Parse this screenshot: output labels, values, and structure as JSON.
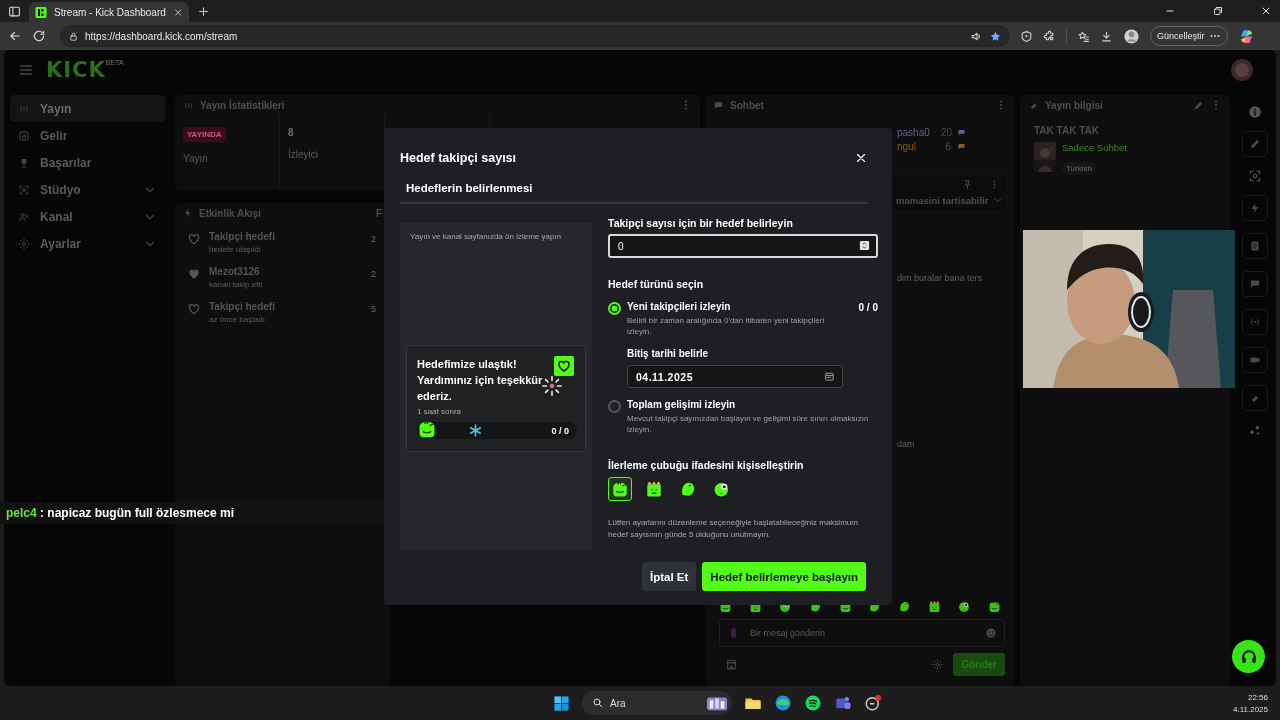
{
  "browser": {
    "tab": {
      "title": "Stream - Kick Dashboard"
    },
    "url": "https://dashboard.kick.com/stream",
    "update_button": "Güncelleştir"
  },
  "header": {
    "logo": "KICK",
    "logo_badge": "BETA"
  },
  "sidebar": {
    "items": [
      {
        "label": "Yayın",
        "selected": true,
        "expandable": false
      },
      {
        "label": "Gelir",
        "selected": false,
        "expandable": false
      },
      {
        "label": "Başarılar",
        "selected": false,
        "expandable": false
      },
      {
        "label": "Stüdyo",
        "selected": false,
        "expandable": true
      },
      {
        "label": "Kanal",
        "selected": false,
        "expandable": true
      },
      {
        "label": "Ayarlar",
        "selected": false,
        "expandable": true
      }
    ]
  },
  "stats_panel": {
    "title": "Yayın İstatistikleri",
    "status_badge": "YAYINDA",
    "status_label": "Yayın",
    "viewers": "8",
    "viewers_label": "İzleyici"
  },
  "activity_panel": {
    "title": "Etkinlik Akışı",
    "column_2": "F",
    "items": [
      {
        "kind": "goal",
        "title": "Takipçi hedefi",
        "subtitle": "hedefe ulaşıldı",
        "time": "2"
      },
      {
        "kind": "follow",
        "title": "Mezot3126",
        "subtitle": "kanalı takip etti",
        "time": "2"
      },
      {
        "kind": "goal",
        "title": "Takipçi hedefi",
        "subtitle": "az önce başladı",
        "time": "5"
      }
    ]
  },
  "chat_panel": {
    "title": "Sohbet",
    "leaders": [
      {
        "name": "pasha0",
        "count": "20",
        "color": "#6b5a9a"
      },
      {
        "name": "ngul",
        "count": "6",
        "color": "#8a5a1c"
      }
    ],
    "pinned": {
      "text": "mamasini tartisabilir"
    },
    "messages": [
      "dim buralar bana ters",
      "dam"
    ],
    "input": {
      "placeholder": "Bir mesaj gönderin"
    },
    "send_button": "Gönder"
  },
  "stream_info": {
    "title": "Yayın bilgisi",
    "stream_title": "TAK TAK TAK",
    "category": "Sadece Sohbet",
    "tags": [
      "Turkish"
    ]
  },
  "overlay_chat": {
    "user": "pelc4",
    "message": ": napicaz bugün full özlesmece mi"
  },
  "modal": {
    "title": "Hedef takipçi sayısı",
    "subtitle": "Hedeflerin belirlenmesi",
    "preview": {
      "caption": "Yayın ve kanal sayfanızda ön izleme yapın",
      "message": "Hedefimize ulaştık! Yardımınız için teşekkür ederiz.",
      "time": "1 saat sonra",
      "progress": "0 / 0"
    },
    "goal_field": {
      "label": "Takipçi sayısı için bir hedef belirleyin",
      "value": "0"
    },
    "type_label": "Hedef türünü seçin",
    "types": [
      {
        "title": "Yeni takipçileri izleyin",
        "description": "Belirli bir zaman aralığında 0'dan itibaren yeni takipçileri izleyin.",
        "selected": true,
        "count": "0 / 0",
        "end_date": {
          "label": "Bitiş tarihi belirle",
          "value": "04.11.2025"
        }
      },
      {
        "title": "Toplam gelişimi izleyin",
        "description": "Mevcut takipçi sayınızdan başlayın ve gelişimi süre sınırı olmaksızın izleyin.",
        "selected": false
      }
    ],
    "emote_label": "İlerleme çubuğu ifadesini kişiselleştirin",
    "emotes": [
      {
        "kind": "frog",
        "selected": true
      },
      {
        "kind": "box",
        "selected": false
      },
      {
        "kind": "blob",
        "selected": false
      },
      {
        "kind": "goggle",
        "selected": false
      }
    ],
    "note": "Lütfen ayarlarını düzenleme seçeneğiyle başlatabileceğiniz maksimum hedef sayısının günde 5 olduğunu unutmayın.",
    "buttons": [
      {
        "label": "İptal Et",
        "kind": "secondary"
      },
      {
        "label": "Hedef belirlemeye başlayın",
        "kind": "primary"
      }
    ]
  },
  "taskbar": {
    "search": {
      "placeholder": "Ara"
    },
    "time": "22:56",
    "date": "4.11.2025"
  }
}
